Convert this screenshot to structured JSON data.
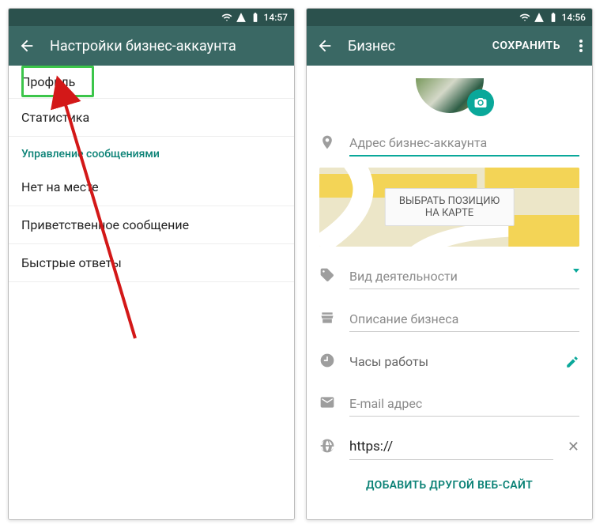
{
  "left": {
    "status_time": "14:57",
    "title": "Настройки бизнес-аккаунта",
    "items": {
      "profile": "Профиль",
      "stats": "Статистика",
      "section": "Управление сообщениями",
      "away": "Нет на месте",
      "greeting": "Приветственное сообщение",
      "quick": "Быстрые ответы"
    }
  },
  "right": {
    "status_time": "14:56",
    "title": "Бизнес",
    "save_label": "СОХРАНИТЬ",
    "address_placeholder": "Адрес бизнес-аккаунта",
    "map_btn": "ВЫБРАТЬ ПОЗИЦИЮ НА КАРТЕ",
    "category_placeholder": "Вид деятельности",
    "description_placeholder": "Описание бизнеса",
    "hours_label": "Часы работы",
    "email_placeholder": "E-mail адрес",
    "url_value": "https://",
    "add_site": "ДОБАВИТЬ ДРУГОЙ ВЕБ-САЙТ"
  }
}
